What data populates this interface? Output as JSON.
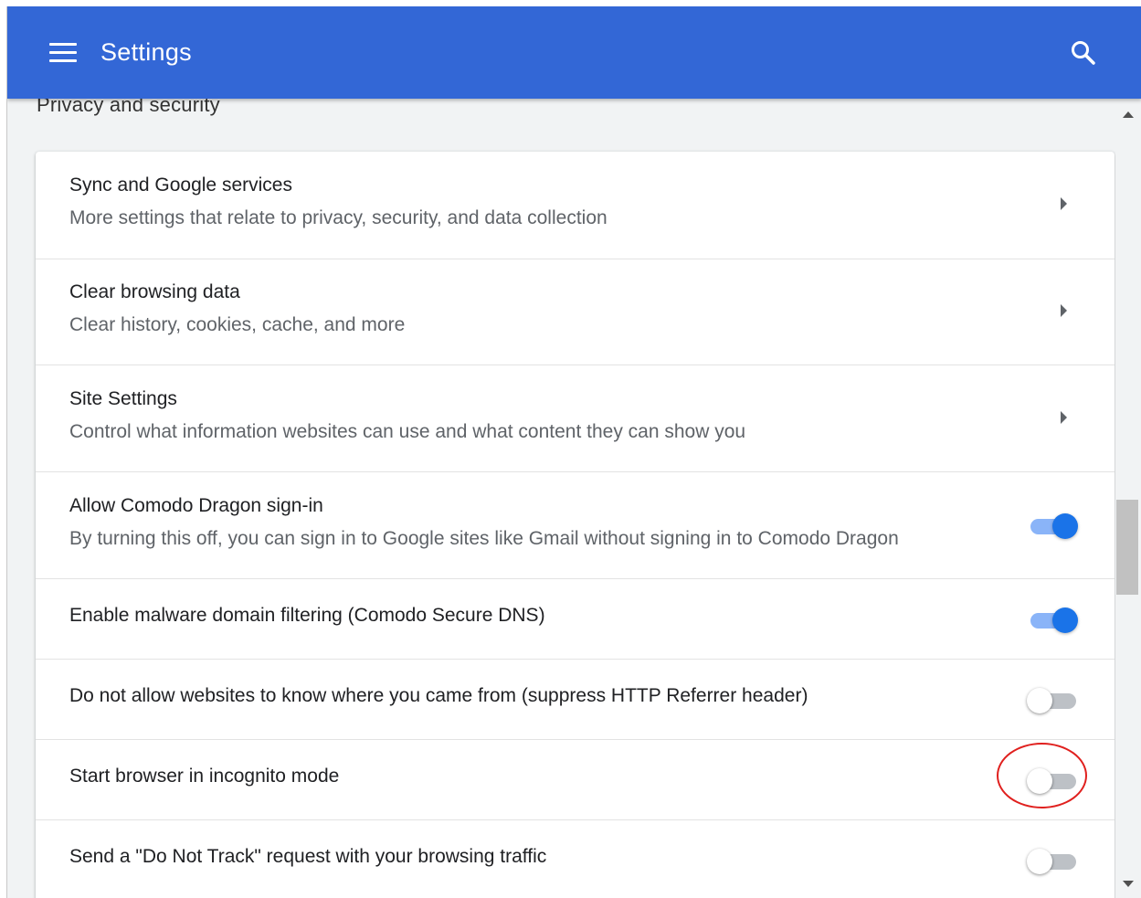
{
  "header": {
    "title": "Settings",
    "menu_icon": "hamburger-menu-icon",
    "search_icon": "search-icon",
    "background_color": "#3367d6"
  },
  "section": {
    "title": "Privacy and security"
  },
  "rows": [
    {
      "title": "Sync and Google services",
      "subtitle": "More settings that relate to privacy, security, and data collection",
      "control": "arrow"
    },
    {
      "title": "Clear browsing data",
      "subtitle": "Clear history, cookies, cache, and more",
      "control": "arrow"
    },
    {
      "title": "Site Settings",
      "subtitle": "Control what information websites can use and what content they can show you",
      "control": "arrow"
    },
    {
      "title": "Allow Comodo Dragon sign-in",
      "subtitle": "By turning this off, you can sign in to Google sites like Gmail without signing in to Comodo Dragon",
      "control": "toggle",
      "enabled": true
    },
    {
      "title": "Enable malware domain filtering (Comodo Secure DNS)",
      "control": "toggle",
      "enabled": true
    },
    {
      "title": "Do not allow websites to know where you came from (suppress HTTP Referrer header)",
      "control": "toggle",
      "enabled": false
    },
    {
      "title": "Start browser in incognito mode",
      "control": "toggle",
      "enabled": false,
      "highlighted": true
    },
    {
      "title": "Send a \"Do Not Track\" request with your browsing traffic",
      "control": "toggle",
      "enabled": false
    }
  ],
  "colors": {
    "toggle_on_knob": "#1a73e8",
    "toggle_on_track": "#8ab4f8",
    "toggle_off_track": "#bdc1c6",
    "highlight_ring": "#e0201e"
  }
}
